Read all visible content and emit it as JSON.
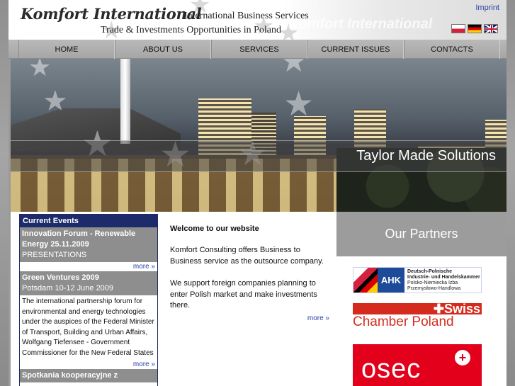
{
  "header": {
    "brand": "Komfort International",
    "tagline_line1": "International Business Services",
    "tagline_line2": "Trade & Investments Opportunities in Poland",
    "watermark": "Komfort International",
    "imprint_link": "Imprint",
    "languages": [
      "Polish",
      "German",
      "English"
    ]
  },
  "nav": {
    "items": [
      {
        "label": "HOME"
      },
      {
        "label": "ABOUT US"
      },
      {
        "label": "SERVICES"
      },
      {
        "label": "CURRENT ISSUES"
      },
      {
        "label": "CONTACTS"
      }
    ]
  },
  "banner": {
    "slogan": "Taylor Made Solutions"
  },
  "events": {
    "title": "Current Events",
    "items": [
      {
        "heading": "Innovation Forum - Renewable Energy 25.11.2009",
        "subheading": "PRESENTATIONS",
        "more": "more »"
      },
      {
        "heading": "Green Ventures 2009",
        "subheading": "Potsdam 10-12 June 2009",
        "body": "The international partnership forum for environmental and energy technologies under the auspices of the Federal Minister of Transport, Building and Urban Affairs, Wolfgang Tiefensee - Government Commissioner for the New Federal States",
        "more": "more »"
      },
      {
        "heading": "Spotkania kooperacyjne z"
      }
    ]
  },
  "welcome": {
    "title": "Welcome to our website",
    "paragraph1": "Komfort Consulting offers Business to Business service as the outsource company.",
    "paragraph2": "We support foreign companies planning to enter Polish market and make investments there.",
    "more": "more »"
  },
  "partners": {
    "title": "Our Partners",
    "ahk": {
      "abbr": "AHK",
      "line1": "Deutsch-Polnische",
      "line2": "Industrie- und Handelskammer",
      "line3": "Polsko-Niemiecka Izba",
      "line4": "Przemysłowo-Handlowa"
    },
    "swiss": {
      "top": "Swiss",
      "bottom": "Chamber Poland"
    },
    "osec": {
      "name": "osec",
      "plus": "+"
    }
  },
  "colors": {
    "nav_bg": "#b0b0b0",
    "events_header": "#1d2b6b",
    "event_heading_bg": "#8e8e8e",
    "link": "#2b3ea8",
    "swiss_red": "#d52b1e",
    "osec_red": "#e3001b"
  }
}
